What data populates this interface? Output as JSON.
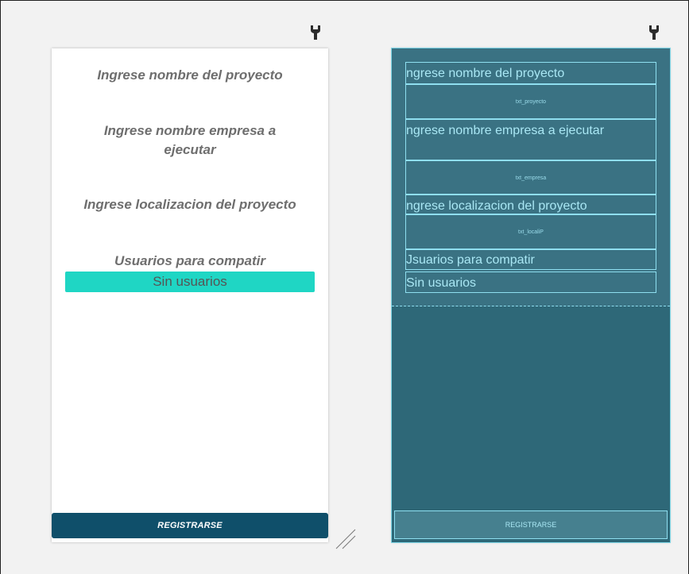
{
  "design_view": {
    "labels": [
      "Ingrese nombre del proyecto",
      "Ingrese nombre empresa a ejecutar",
      "Ingrese localizacion del proyecto",
      "Usuarios para compatir"
    ],
    "users_button": "Sin usuarios",
    "register_button": "REGISTRARSE"
  },
  "blueprint_view": {
    "label_project": "ngrese nombre del proyecto",
    "id_project": "txt_proyecto",
    "label_company": "ngrese nombre empresa a ejecutar",
    "id_company": "txt_empresa",
    "label_location": "ngrese localizacion del proyecto",
    "id_location": "txt_localiP",
    "label_users": "Jsuarios para compatir",
    "users_button": "Sin usuarios",
    "register_button": "REGISTRARSE"
  },
  "icons": {
    "design_wrench": "wrench-icon",
    "blueprint_wrench": "wrench-icon",
    "resize": "resize-handle-icon"
  },
  "colors": {
    "accent_teal": "#1fd6c4",
    "register_bg": "#0f4f6a",
    "blueprint_bg": "#2e6878",
    "blueprint_line": "#8fdff0"
  }
}
